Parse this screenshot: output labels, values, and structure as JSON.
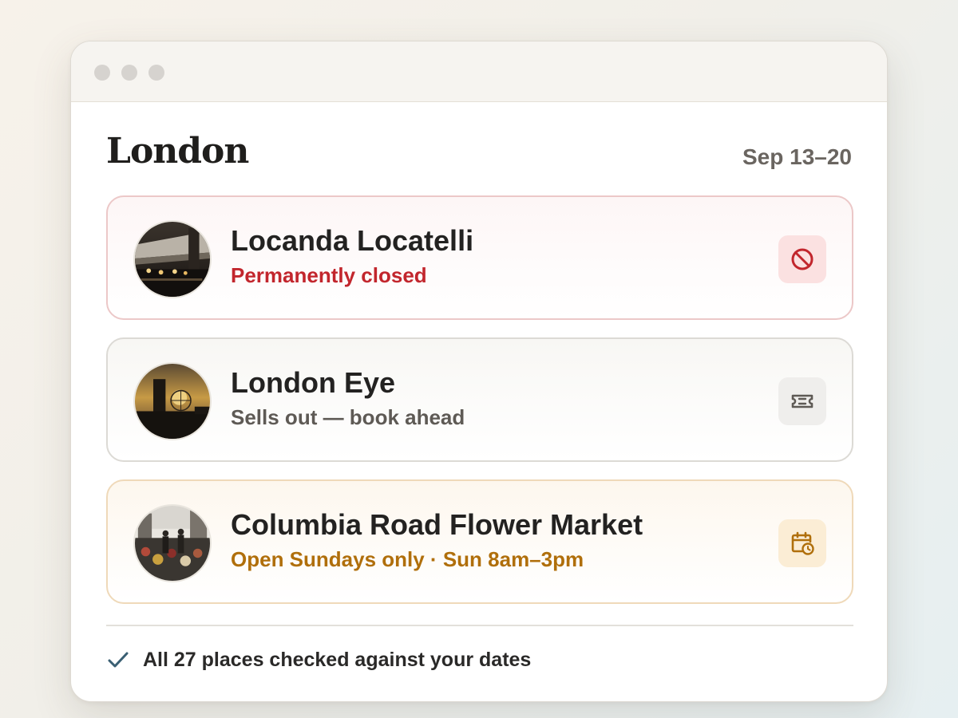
{
  "page": {
    "city": "London",
    "dates": "Sep 13–20"
  },
  "places": [
    {
      "name": "Locanda Locatelli",
      "status": "Permanently closed",
      "status_tone": "red",
      "action_icon": "no-entry-icon",
      "accent": "#c2262d"
    },
    {
      "name": "London Eye",
      "status": "Sells out — book ahead",
      "status_tone": "gray",
      "action_icon": "ticket-icon",
      "accent": "#5e5a55"
    },
    {
      "name": "Columbia Road Flower Market",
      "status": "Open Sundays only · Sun 8am–3pm",
      "status_tone": "amber",
      "action_icon": "calendar-clock-icon",
      "accent": "#b06f0b"
    }
  ],
  "footer": {
    "icon": "check-icon",
    "text": "All 27 places checked against your dates"
  }
}
